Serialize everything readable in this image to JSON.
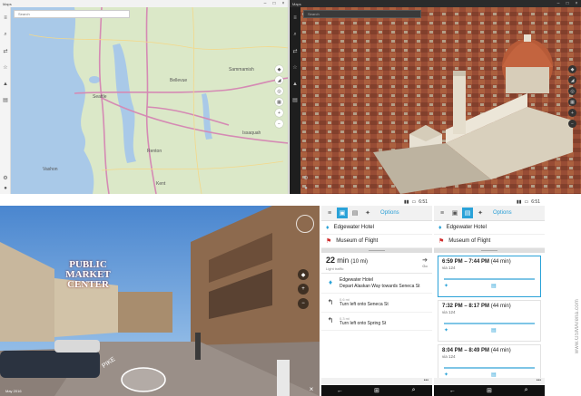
{
  "top_left": {
    "title": "Maps",
    "search_placeholder": "Search",
    "map_labels": [
      "Seattle",
      "Bellevue",
      "Sammamish",
      "Renton",
      "Kent",
      "Issaquah",
      "Vashon"
    ]
  },
  "top_right": {
    "title": "Maps",
    "search_placeholder": "Search"
  },
  "street": {
    "date": "May 2016",
    "sign": [
      "PUBLIC",
      "MARKET",
      "CENTER"
    ],
    "pike": "PIKE"
  },
  "phone1": {
    "time": "6:51",
    "options": "Options",
    "start": "Edgewater Hotel",
    "destination": "Museum of Flight",
    "duration": "22",
    "duration_unit": "min",
    "distance": "(10 mi)",
    "traffic": "Light traffic",
    "go": "Go",
    "steps": [
      {
        "dist": "",
        "text": "Edgewater Hotel\nDepart Alaskan Way towards Seneca St"
      },
      {
        "dist": "0.6 mi",
        "text": "Turn left onto Seneca St"
      },
      {
        "dist": "0.3 mi",
        "text": "Turn left onto Spring St"
      }
    ]
  },
  "phone2": {
    "time": "6:51",
    "options": "Options",
    "start": "Edgewater Hotel",
    "destination": "Museum of Flight",
    "routes": [
      {
        "time": "6:59 PM – 7:44 PM",
        "dur": "(44 min)",
        "via": "via 124"
      },
      {
        "time": "7:32 PM – 8:17 PM",
        "dur": "(44 min)",
        "via": "via 124"
      },
      {
        "time": "8:04 PM – 8:49 PM",
        "dur": "(44 min)",
        "via": "via 124"
      }
    ]
  },
  "watermark": "www.GSMArena.com",
  "colors": {
    "accent": "#2aa2d8",
    "water": "#a9c9e8",
    "land": "#dbe8c8",
    "roofs": "#b45a37"
  }
}
